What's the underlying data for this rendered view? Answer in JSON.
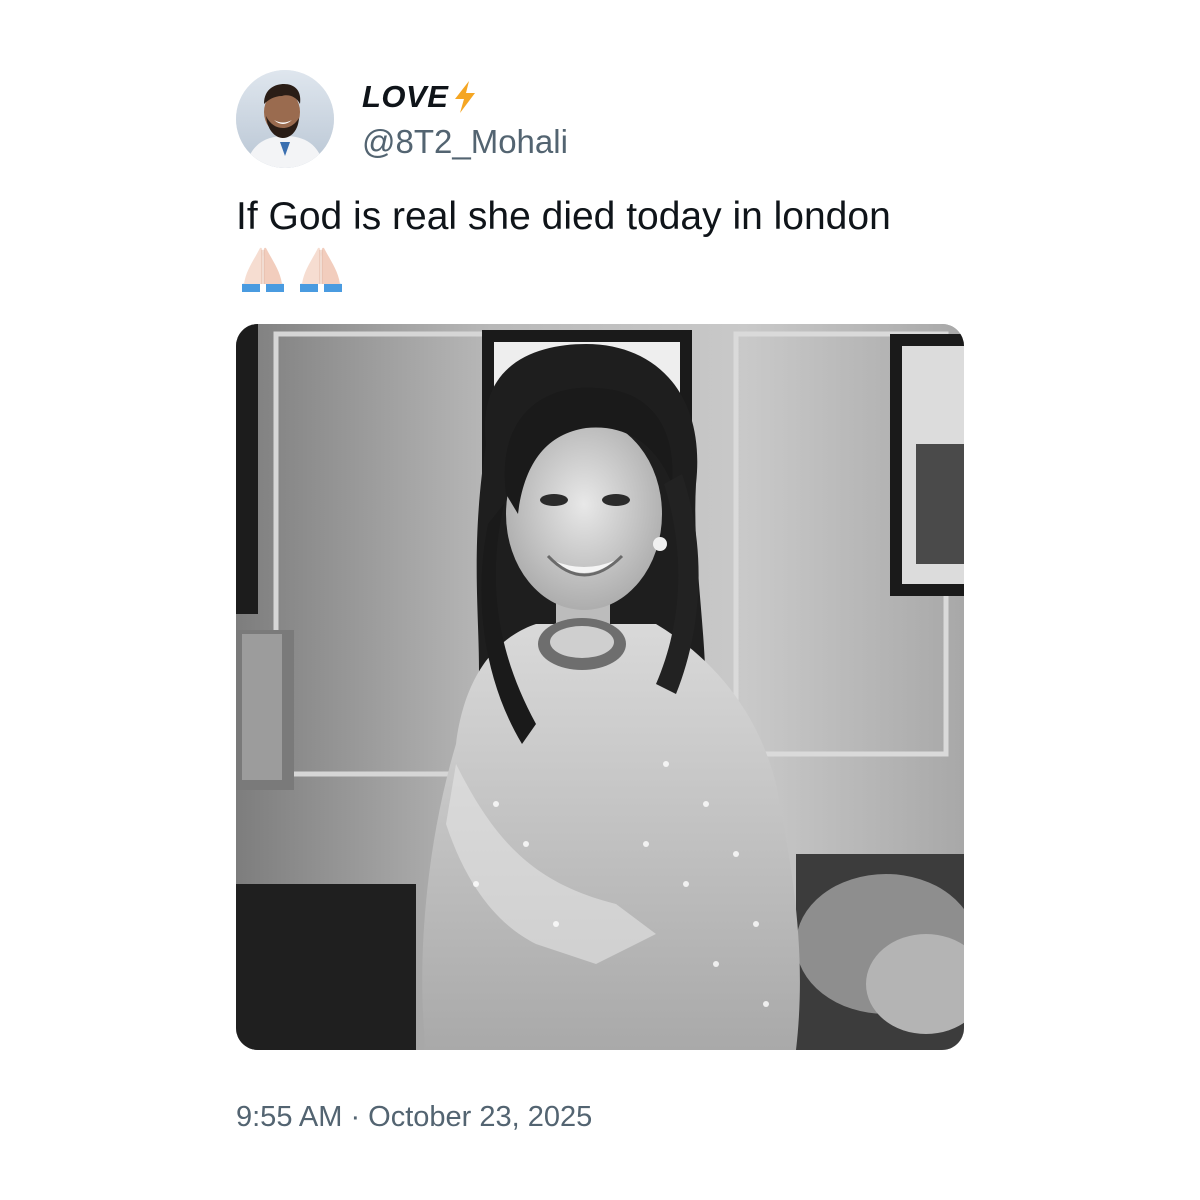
{
  "author": {
    "display_name": "LOVE",
    "display_name_icon": "lightning-bolt-emoji",
    "handle": "@8T2_Mohali",
    "avatar_icon": "user-avatar-photo"
  },
  "tweet": {
    "text": "If God is real she died today in london",
    "emoji": [
      "folded-hands-emoji",
      "folded-hands-emoji"
    ],
    "media_description_icon": "attached-photo",
    "timestamp": "9:55 AM · October 23, 2025"
  },
  "colors": {
    "text_primary": "#0f1419",
    "text_secondary": "#536471",
    "bolt": "#f5a623",
    "background": "#ffffff"
  }
}
